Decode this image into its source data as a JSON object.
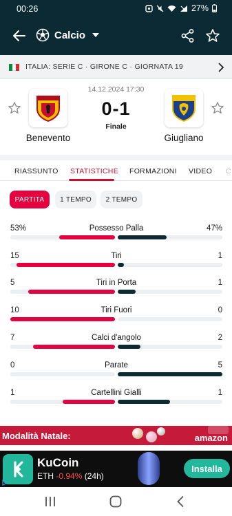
{
  "status_bar": {
    "time": "00:26",
    "battery": "27%"
  },
  "app_bar": {
    "sport": "Calcio",
    "icons": [
      "back-arrow-icon",
      "soccer-ball-icon",
      "share-icon",
      "star-icon"
    ]
  },
  "league": {
    "text": "ITALIA: SERIE C · GIRONE C · GIORNATA 19"
  },
  "match": {
    "datetime": "14.12.2024 17:30",
    "home": "Benevento",
    "away": "Giugliano",
    "score": "0-1",
    "status": "Finale"
  },
  "tabs": [
    {
      "label": "RIASSUNTO",
      "active": false
    },
    {
      "label": "STATISTICHE",
      "active": true
    },
    {
      "label": "FORMAZIONI",
      "active": false
    },
    {
      "label": "VIDEO",
      "active": false
    },
    {
      "label": "C",
      "active": false
    }
  ],
  "periods": [
    {
      "label": "PARTITA",
      "active": true
    },
    {
      "label": "1 TEMPO",
      "active": false
    },
    {
      "label": "2 TEMPO",
      "active": false
    }
  ],
  "stats": [
    {
      "label": "Possesso Palla",
      "home": "53%",
      "away": "47%",
      "home_frac": 0.53,
      "away_frac": 0.47
    },
    {
      "label": "Tiri",
      "home": "15",
      "away": "1",
      "home_frac": 0.94,
      "away_frac": 0.06
    },
    {
      "label": "Tiri in Porta",
      "home": "5",
      "away": "1",
      "home_frac": 0.83,
      "away_frac": 0.17
    },
    {
      "label": "Tiri Fuori",
      "home": "10",
      "away": "0",
      "home_frac": 1.0,
      "away_frac": 0.0
    },
    {
      "label": "Calci d'angolo",
      "home": "7",
      "away": "2",
      "home_frac": 0.78,
      "away_frac": 0.22
    },
    {
      "label": "Parate",
      "home": "0",
      "away": "5",
      "home_frac": 0.0,
      "away_frac": 1.0
    },
    {
      "label": "Cartellini Gialli",
      "home": "1",
      "away": "1",
      "home_frac": 0.5,
      "away_frac": 0.5
    }
  ],
  "ads": {
    "banner": {
      "text": "Modalità Natale:",
      "brand": "amazon"
    },
    "app": {
      "name": "KuCoin",
      "ticker": "ETH",
      "change": "-0.94%",
      "period": "(24h)",
      "cta": "Installa"
    }
  },
  "colors": {
    "header": "#0b2a33",
    "accent": "#e4023f",
    "away_bar": "#0d2a33"
  }
}
